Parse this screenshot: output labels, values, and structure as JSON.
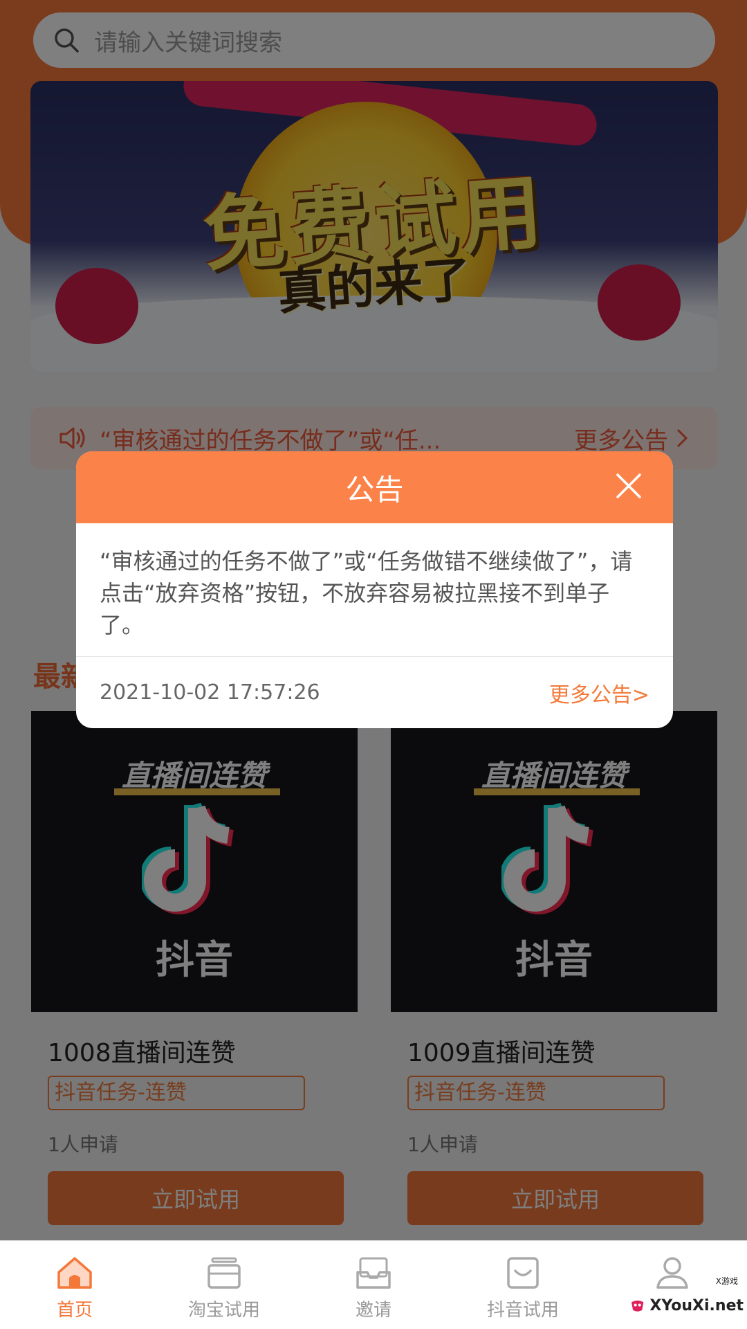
{
  "search": {
    "placeholder": "请输入关键词搜索"
  },
  "banner": {
    "line1": "免费试用",
    "line2": "真的来了"
  },
  "notice_bar": {
    "text": "“审核通过的任务不做了”或“任...",
    "more": "更多公告"
  },
  "section": {
    "title": "最新"
  },
  "cards": [
    {
      "caption": "直播间连赞",
      "brand": "抖音",
      "title": "1008直播间连赞",
      "tag": "抖音任务-连赞",
      "applicants": "1人申请",
      "button": "立即试用"
    },
    {
      "caption": "直播间连赞",
      "brand": "抖音",
      "title": "1009直播间连赞",
      "tag": "抖音任务-连赞",
      "applicants": "1人申请",
      "button": "立即试用"
    }
  ],
  "bottom_nav": [
    {
      "label": "首页",
      "icon": "home-icon",
      "active": true
    },
    {
      "label": "淘宝试用",
      "icon": "box-icon",
      "active": false
    },
    {
      "label": "邀请",
      "icon": "inbox-icon",
      "active": false
    },
    {
      "label": "抖音试用",
      "icon": "tray-icon",
      "active": false
    },
    {
      "label": "",
      "icon": "user-icon",
      "active": false
    }
  ],
  "modal": {
    "title": "公告",
    "body": "“审核通过的任务不做了”或“任务做错不继续做了”，请点击“放弃资格”按钮，不放弃容易被拉黑接不到单子了。",
    "date": "2021-10-02 17:57:26",
    "more": "更多公告>"
  },
  "watermark": {
    "text": "XYouXi.net",
    "small": "X游戏"
  },
  "colors": {
    "accent": "#f4783a",
    "modal_header": "#fb8249",
    "notice_text": "#ef5a3b"
  }
}
